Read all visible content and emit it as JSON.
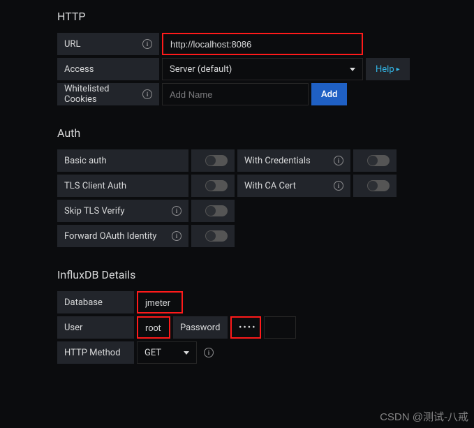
{
  "sections": {
    "http": {
      "title": "HTTP"
    },
    "auth": {
      "title": "Auth"
    },
    "influx": {
      "title": "InfluxDB Details"
    }
  },
  "http": {
    "url_label": "URL",
    "url_value": "http://localhost:8086",
    "access_label": "Access",
    "access_value": "Server (default)",
    "help_label": "Help",
    "cookies_label": "Whitelisted Cookies",
    "cookies_placeholder": "Add Name",
    "cookies_value": "",
    "add_label": "Add"
  },
  "auth": {
    "basic_auth_label": "Basic auth",
    "basic_auth_on": false,
    "with_credentials_label": "With Credentials",
    "with_credentials_on": false,
    "tls_client_label": "TLS Client Auth",
    "tls_client_on": false,
    "with_ca_label": "With CA Cert",
    "with_ca_on": false,
    "skip_tls_label": "Skip TLS Verify",
    "skip_tls_on": false,
    "forward_oauth_label": "Forward OAuth Identity",
    "forward_oauth_on": false
  },
  "influx": {
    "database_label": "Database",
    "database_value": "jmeter",
    "user_label": "User",
    "user_value": "root",
    "password_label": "Password",
    "password_value": "••••",
    "method_label": "HTTP Method",
    "method_value": "GET"
  },
  "watermark": "CSDN @测试-八戒"
}
